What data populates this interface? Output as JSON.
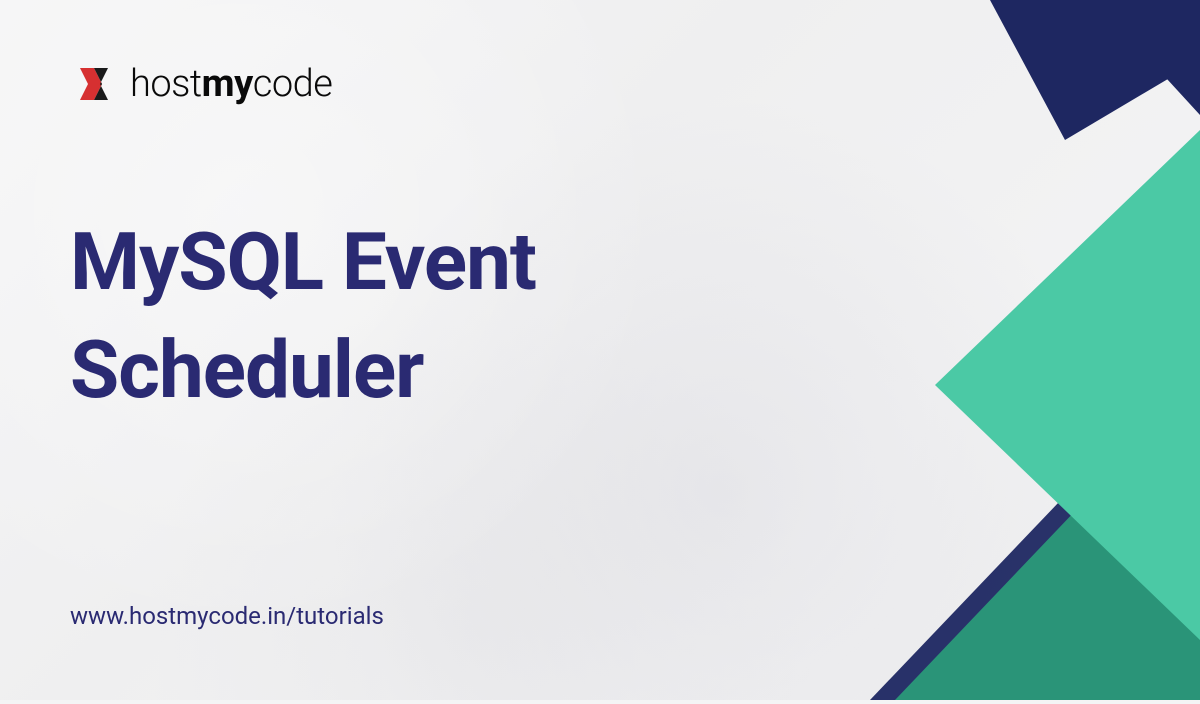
{
  "logo": {
    "text_light1": "host",
    "text_bold": "my",
    "text_light2": "code"
  },
  "title": "MySQL Event Scheduler",
  "url": "www.hostmycode.in/tutorials",
  "colors": {
    "primary_text": "#2a2a72",
    "navy": "#1e2761",
    "teal": "#3cb795",
    "dark_teal": "#2a9478",
    "logo_red": "#d63031"
  }
}
